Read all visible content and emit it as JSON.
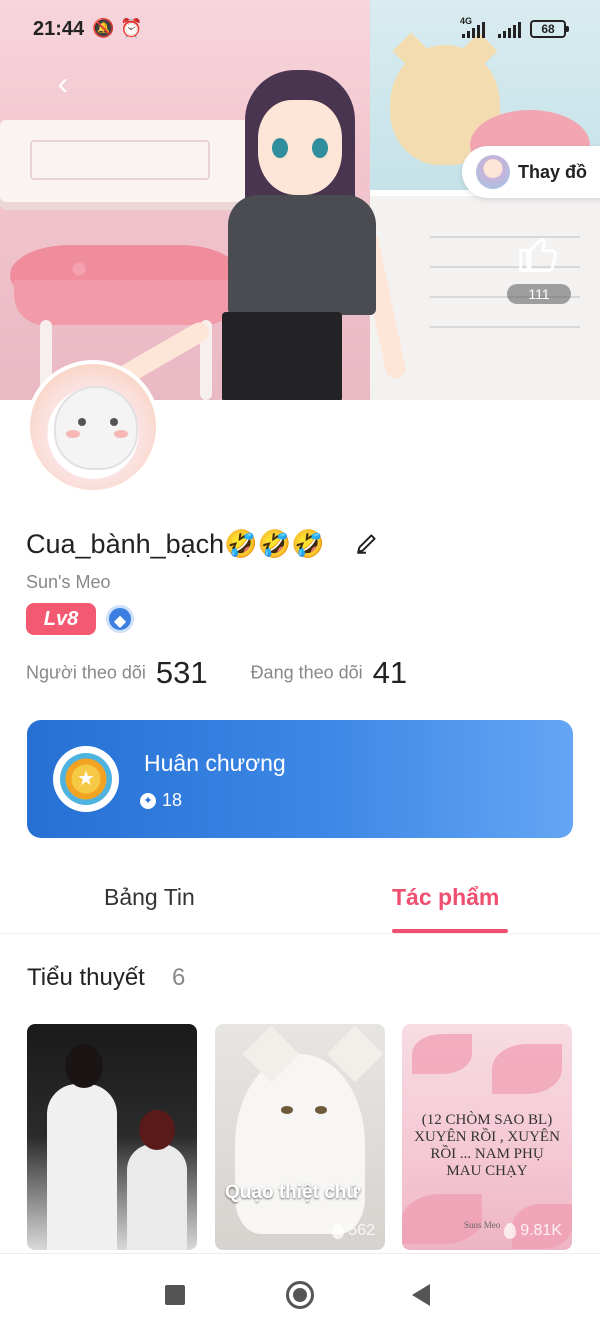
{
  "status_bar": {
    "time": "21:44",
    "network": "4G",
    "battery": "68"
  },
  "header": {
    "change_outfit_label": "Thay đồ",
    "like_count": "111"
  },
  "profile": {
    "username": "Cua_bành_bạch🤣🤣🤣",
    "subname": "Sun's Meo",
    "level": "Lv8",
    "followers_label": "Người theo dõi",
    "followers_count": "531",
    "following_label": "Đang theo dõi",
    "following_count": "41"
  },
  "medal_card": {
    "title": "Huân chương",
    "count": "18"
  },
  "tabs": [
    {
      "label": "Bảng Tin",
      "active": false
    },
    {
      "label": "Tác phẩm",
      "active": true
    }
  ],
  "section": {
    "title": "Tiểu thuyết",
    "count": "6"
  },
  "books": [
    {
      "caption": "",
      "views": "",
      "title": "",
      "author": ""
    },
    {
      "caption": "Quạo thiệt chứ",
      "views": "562",
      "title": "",
      "author": ""
    },
    {
      "caption": "",
      "views": "9.81K",
      "title": "(12 CHÒM SAO BL) XUYÊN RỒI , XUYÊN RỒI ... NAM PHỤ MAU CHẠY",
      "author": "Suns Meo"
    }
  ],
  "colors": {
    "accent": "#f05070",
    "level_badge": "#f35a72",
    "medal_card_start": "#2670d4",
    "medal_card_end": "#64a6f4"
  },
  "icons": {
    "back": "chevron-left-icon",
    "edit": "pencil-icon",
    "like": "thumbs-up-icon",
    "verify": "verified-badge-icon",
    "medal": "medal-icon",
    "views": "flame-icon"
  }
}
